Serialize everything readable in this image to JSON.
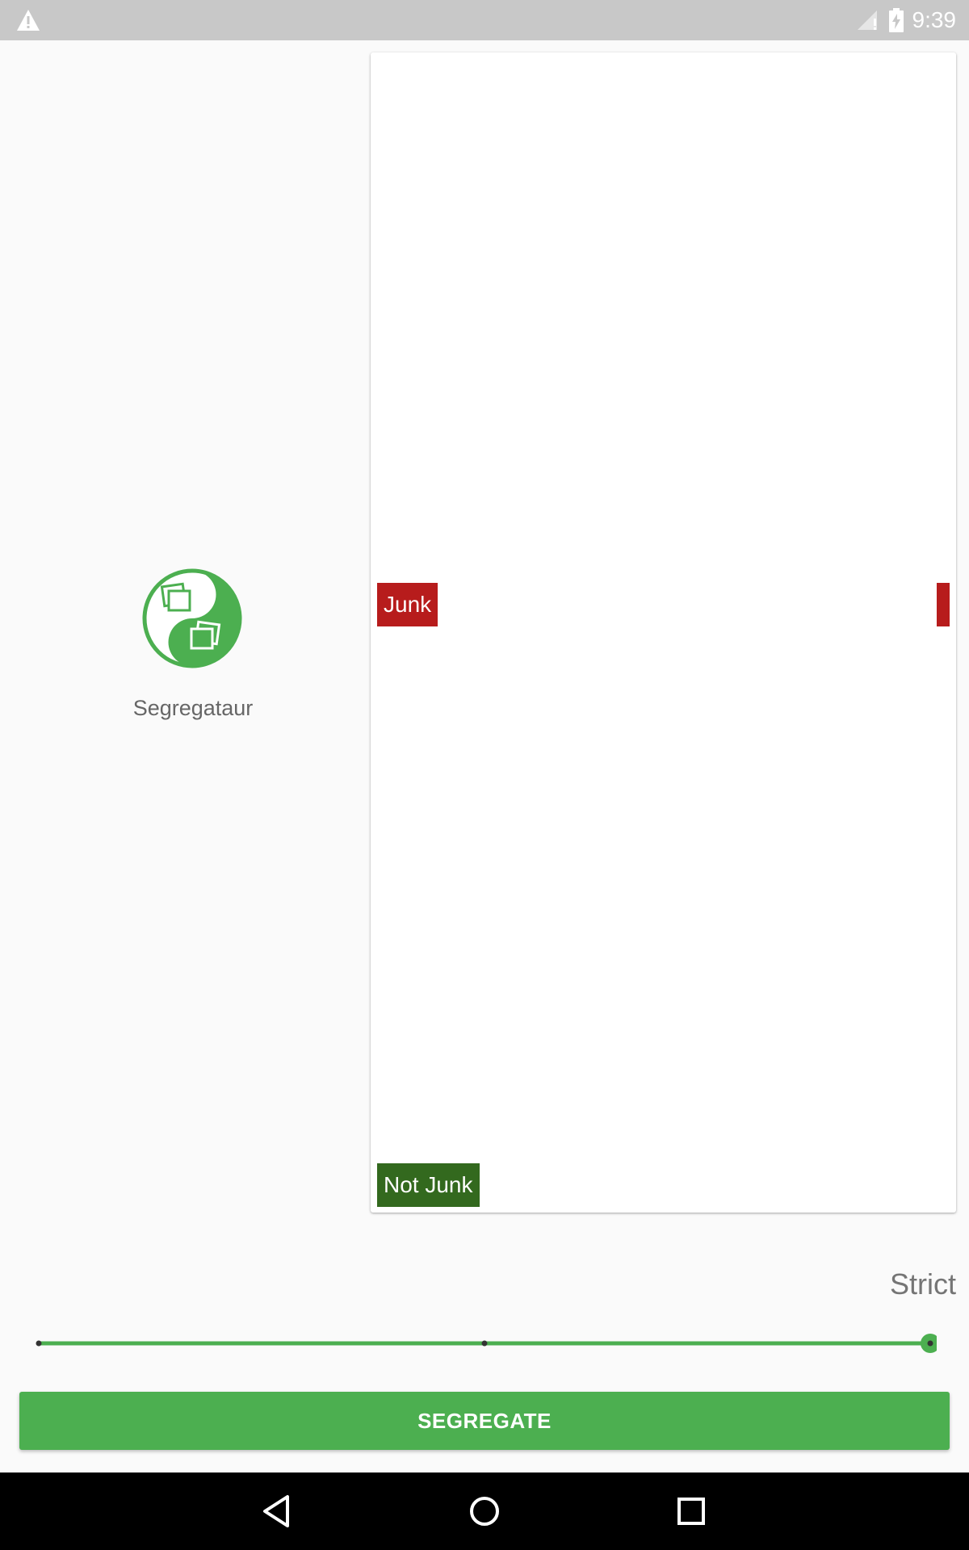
{
  "status_bar": {
    "time": "9:39",
    "icons": [
      "warning-icon",
      "signal-icon",
      "battery-charging-icon"
    ]
  },
  "app": {
    "name": "Segregataur",
    "logo_icon": "yin-yang-photos-icon",
    "brand_color": "#4caf50"
  },
  "card": {
    "junk_label": "Junk",
    "junk_color": "#b71c1c",
    "not_junk_label": "Not Junk",
    "not_junk_color": "#33691e"
  },
  "strictness": {
    "label": "Strict",
    "steps": 3,
    "value_index": 2
  },
  "actions": {
    "segregate_label": "SEGREGATE"
  },
  "nav_bar": {
    "icons": [
      "back-icon",
      "home-icon",
      "recents-icon"
    ]
  }
}
